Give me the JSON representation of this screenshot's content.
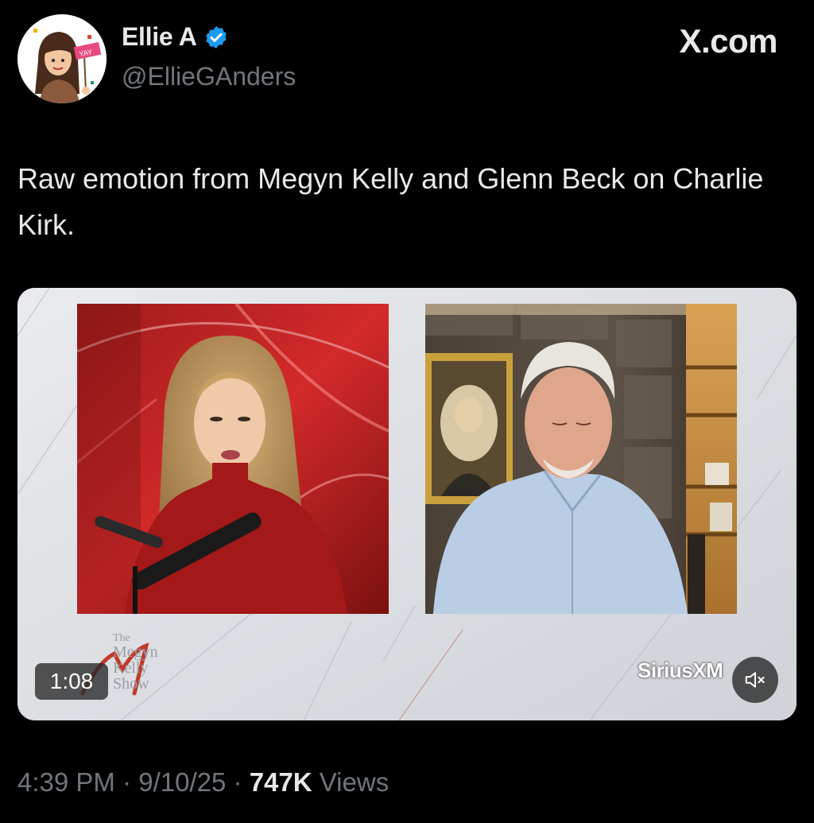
{
  "author": {
    "display_name": "Ellie A",
    "handle": "@EllieGAnders",
    "verified": true,
    "avatar_icon": "bitmoji-avatar-with-yay-flag",
    "avatar_flag_text": "YAY"
  },
  "brand": "X.com",
  "tweet": {
    "text": "Raw emotion from Megyn Kelly and Glenn Beck on Charlie Kirk."
  },
  "media": {
    "duration": "1:08",
    "show_title_lines": [
      "The",
      "Megyn",
      "Kelly",
      "Show"
    ],
    "network_logo": "SiriusXM",
    "mute_icon": "speaker-muted-icon"
  },
  "meta": {
    "time": "4:39 PM",
    "date": "9/10/25",
    "separator": "·",
    "views_count": "747K",
    "views_label": "Views"
  },
  "colors": {
    "background": "#000000",
    "text_primary": "#e7e9ea",
    "text_secondary": "#71767b",
    "verified_blue": "#1d9bf0"
  }
}
